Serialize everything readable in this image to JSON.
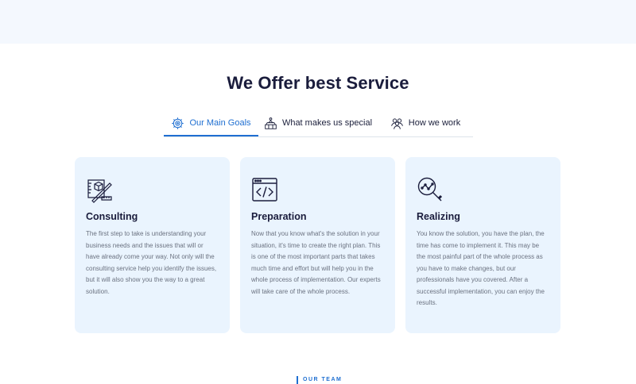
{
  "section": {
    "title": "We Offer best Service"
  },
  "tabs": [
    {
      "label": "Our Main Goals",
      "icon": "gear-target-icon",
      "active": true
    },
    {
      "label": "What makes us special",
      "icon": "podium-icon",
      "active": false
    },
    {
      "label": "How we work",
      "icon": "team-icon",
      "active": false
    }
  ],
  "cards": [
    {
      "title": "Consulting",
      "icon": "blueprint-tools-icon",
      "text": "The first step to take is understanding your business needs and the issues that will or have already come your way. Not only will the consulting service help you identify the issues, but it will also show you the way to a great solution."
    },
    {
      "title": "Preparation",
      "icon": "code-window-icon",
      "text": "Now that you know what's the solution in your situation, it's time to create the right plan. This is one of the most important parts that takes much time and effort but will help you in the whole process of implementation. Our experts will take care of the whole process."
    },
    {
      "title": "Realizing",
      "icon": "magnifier-chart-icon",
      "text": "You know the solution, you have the plan, the time has come to implement it. This may be the most painful part of the whole process as you have to make changes, but our professionals have you covered. After a successful implementation, you can enjoy the results."
    }
  ],
  "team": {
    "label": "OUR TEAM"
  },
  "colors": {
    "accent": "#1f6fd1",
    "card_bg": "#eaf4fe",
    "top_band": "#f4f8fe",
    "heading": "#1a1c3c"
  }
}
